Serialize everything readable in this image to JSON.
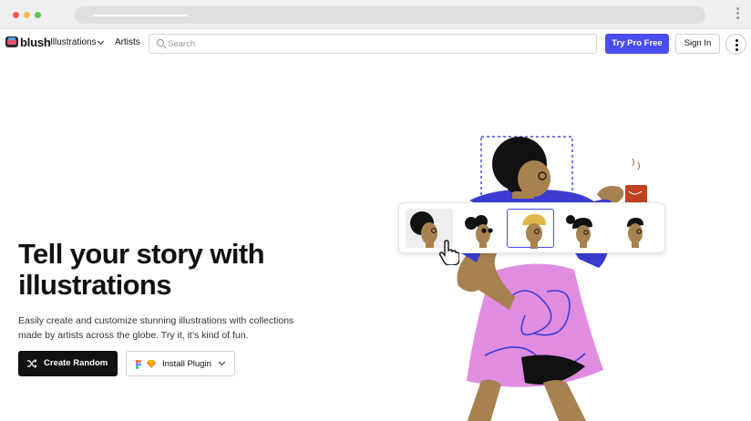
{
  "browser": {
    "window_controls": [
      "close",
      "minimize",
      "maximize"
    ],
    "menu_icon": "kebab-vertical-icon"
  },
  "nav": {
    "brand": "blush",
    "logo_icon": "blush-logo-icon",
    "illustrations_label": "Illustrations",
    "artists_label": "Artists",
    "search_placeholder": "Search",
    "search_value": "",
    "try_pro_label": "Try Pro Free",
    "sign_in_label": "Sign In",
    "more_icon": "kebab-vertical-icon"
  },
  "hero": {
    "title": "Tell your story with illustrations",
    "subtitle": "Easily create and customize stunning illustrations with collections made by artists across the globe. Try it, it’s kind of fun.",
    "create_random_label": "Create Random",
    "create_random_icon": "shuffle-icon",
    "install_plugin_label": "Install Plugin",
    "install_plugin_icons": [
      "figma-icon",
      "sketch-icon",
      "chevron-down-icon"
    ]
  },
  "illustration": {
    "head_variants": [
      "afro-head",
      "bun-sunglasses-head",
      "beanie-head",
      "ponytail-head",
      "short-hair-head"
    ],
    "selected_variant": 3,
    "colors": {
      "accent": "#4a4cf1",
      "skin": "#a7814f",
      "dress": "#e08ce0",
      "shirt": "#3b3bd2",
      "hair": "#111111"
    }
  }
}
